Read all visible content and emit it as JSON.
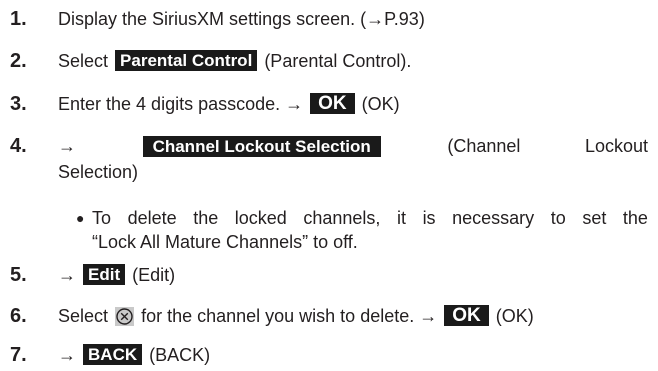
{
  "steps": [
    {
      "number": "1.",
      "text": "Display the SiriusXM settings screen. (→P.93)"
    },
    {
      "number": "2.",
      "before": "Select",
      "button": "Parental Control",
      "after": "(Parental Control)."
    },
    {
      "number": "3.",
      "before": "Enter the 4 digits passcode. →",
      "button": "OK",
      "after": "(OK)"
    },
    {
      "number": "4.",
      "arrow": "→",
      "button": "Channel Lockout Selection",
      "after_word1": "(Channel",
      "after_word2": "Lockout",
      "line2": "Selection)"
    },
    {
      "number": "5.",
      "arrow": "→",
      "button": "Edit",
      "after": "(Edit)"
    },
    {
      "number": "6.",
      "before": "Select",
      "after_icon": "for the channel you wish to delete. →",
      "button": "OK",
      "after": "(OK)",
      "icon": "circle-x-icon"
    },
    {
      "number": "7.",
      "arrow": "→",
      "button": "BACK",
      "after": "(BACK)"
    }
  ],
  "note": {
    "bullet": "●",
    "line1_words": [
      "To",
      "delete",
      "the",
      "locked",
      "channels,",
      "it",
      "is",
      "necessary",
      "to",
      "set",
      "the"
    ],
    "line2": "“Lock All Mature Channels” to off."
  },
  "colors": {
    "text": "#231f20",
    "button_bg": "#1a1a1a",
    "button_text": "#ffffff",
    "icon_bg": "#c9c9c9"
  }
}
